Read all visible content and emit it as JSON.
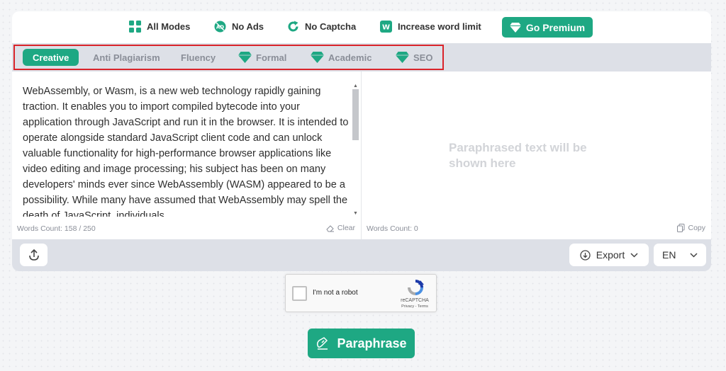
{
  "features": [
    {
      "label": "All Modes",
      "icon": "grid-icon"
    },
    {
      "label": "No Ads",
      "icon": "no-ads-icon"
    },
    {
      "label": "No Captcha",
      "icon": "refresh-icon"
    },
    {
      "label": "Increase word limit",
      "icon": "word-icon"
    }
  ],
  "premium": {
    "label": "Go Premium",
    "icon": "diamond-icon"
  },
  "modes": [
    {
      "label": "Creative",
      "active": true,
      "premium": false
    },
    {
      "label": "Anti Plagiarism",
      "active": false,
      "premium": false
    },
    {
      "label": "Fluency",
      "active": false,
      "premium": false
    },
    {
      "label": "Formal",
      "active": false,
      "premium": true
    },
    {
      "label": "Academic",
      "active": false,
      "premium": true
    },
    {
      "label": "SEO",
      "active": false,
      "premium": true
    }
  ],
  "input": {
    "text": "WebAssembly, or Wasm, is a new web technology rapidly gaining traction. It enables you to import compiled bytecode into your application through JavaScript and run it in the browser. It is intended to operate alongside standard JavaScript client code and can unlock valuable functionality for high-performance browser applications like video editing and image processing; his subject has been on many developers' minds ever since WebAssembly (WASM) appeared to be a possibility. While many have assumed that WebAssembly may spell the death of JavaScript, individuals",
    "word_count": "Words Count: 158 / 250",
    "clear_label": "Clear"
  },
  "output": {
    "placeholder": "Paraphrased text will be shown here",
    "word_count": "Words Count: 0",
    "copy_label": "Copy"
  },
  "toolbar": {
    "export_label": "Export",
    "language": "EN"
  },
  "captcha": {
    "label": "I'm not a robot",
    "brand": "reCAPTCHA",
    "links": "Privacy - Terms"
  },
  "paraphrase_button": "Paraphrase",
  "colors": {
    "accent": "#1ea883",
    "highlight_outline": "#d9242a",
    "bar": "#dde0e7"
  }
}
